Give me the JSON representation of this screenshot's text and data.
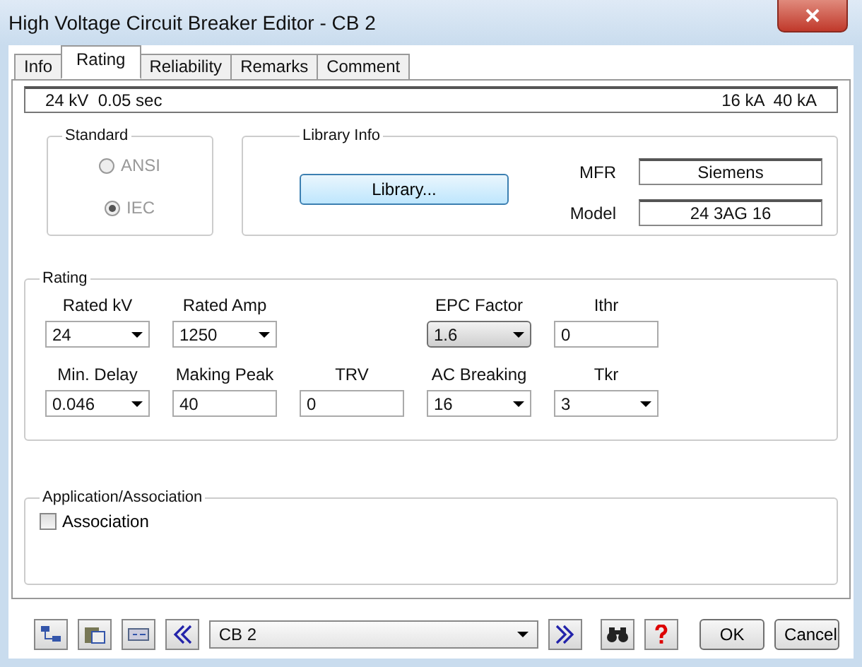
{
  "window": {
    "title": "High Voltage Circuit Breaker Editor - CB 2"
  },
  "tabs": [
    {
      "label": "Info",
      "selected": false
    },
    {
      "label": "Rating",
      "selected": true
    },
    {
      "label": "Reliability",
      "selected": false
    },
    {
      "label": "Remarks",
      "selected": false
    },
    {
      "label": "Comment",
      "selected": false
    }
  ],
  "summary": {
    "left": "24 kV  0.05 sec",
    "right": "16 kA  40 kA"
  },
  "standard": {
    "title": "Standard",
    "disabled": true,
    "options": [
      {
        "label": "ANSI",
        "selected": false
      },
      {
        "label": "IEC",
        "selected": true
      }
    ]
  },
  "library_info": {
    "title": "Library Info",
    "button": "Library...",
    "fields": [
      {
        "label": "MFR",
        "value": "Siemens"
      },
      {
        "label": "Model",
        "value": "24 3AG 16"
      }
    ]
  },
  "rating": {
    "title": "Rating",
    "rows": [
      [
        {
          "label": "Rated kV",
          "value": "24",
          "kind": "dropdown"
        },
        {
          "label": "Rated Amp",
          "value": "1250",
          "kind": "dropdown"
        },
        "",
        {
          "label": "EPC Factor",
          "value": "1.6",
          "kind": "button_dropdown"
        },
        {
          "label": "Ithr",
          "value": "0",
          "kind": "text"
        }
      ],
      [
        {
          "label": "Min. Delay",
          "value": "0.046",
          "kind": "dropdown"
        },
        {
          "label": "Making Peak",
          "value": "40",
          "kind": "text"
        },
        {
          "label": "TRV",
          "value": "0",
          "kind": "text"
        },
        {
          "label": "AC Breaking",
          "value": "16",
          "kind": "dropdown"
        },
        {
          "label": "Tkr",
          "value": "3",
          "kind": "dropdown"
        }
      ]
    ]
  },
  "application": {
    "title": "Application/Association",
    "checkbox": {
      "label": "Association",
      "checked": false
    }
  },
  "toolbar": {
    "device": "CB 2",
    "ok": "OK",
    "cancel": "Cancel"
  }
}
